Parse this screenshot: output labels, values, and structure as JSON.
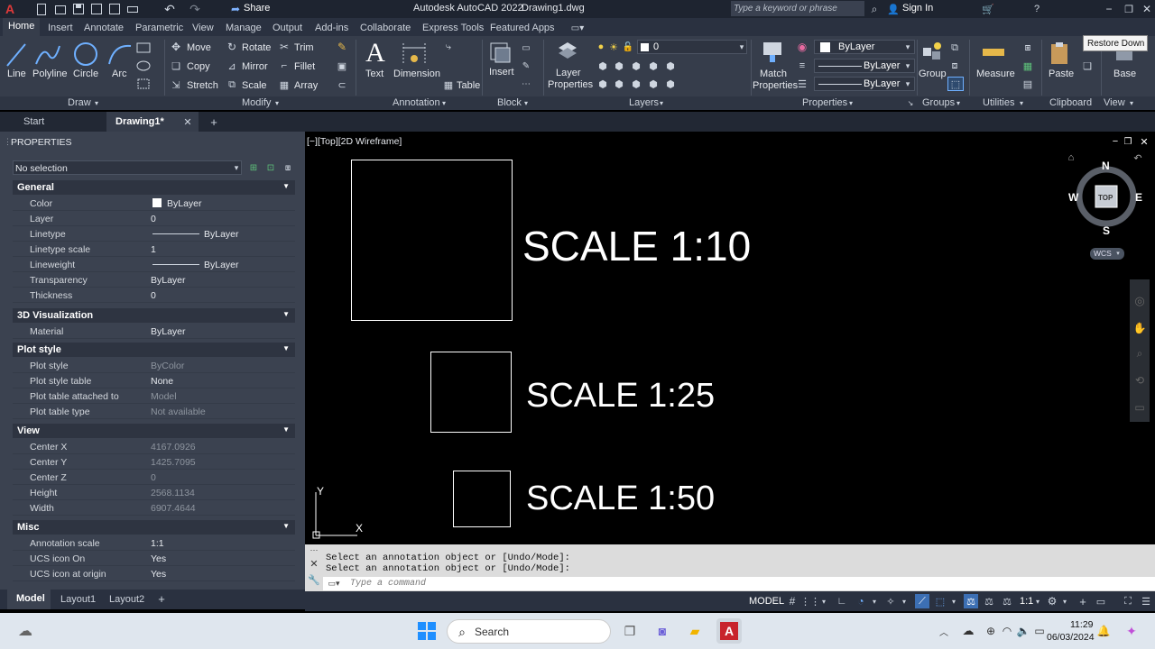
{
  "titlebar": {
    "share": "Share",
    "app_title": "Autodesk AutoCAD 2022",
    "file_name": "Drawing1.dwg",
    "search_placeholder": "Type a keyword or phrase",
    "sign_in": "Sign In"
  },
  "ribbon_tabs": [
    "Home",
    "Insert",
    "Annotate",
    "Parametric",
    "View",
    "Manage",
    "Output",
    "Add-ins",
    "Collaborate",
    "Express Tools",
    "Featured Apps"
  ],
  "draw": {
    "line": "Line",
    "polyline": "Polyline",
    "circle": "Circle",
    "arc": "Arc",
    "group": "Draw"
  },
  "modify": {
    "move": "Move",
    "rotate": "Rotate",
    "trim": "Trim",
    "copy": "Copy",
    "mirror": "Mirror",
    "fillet": "Fillet",
    "stretch": "Stretch",
    "scale": "Scale",
    "array": "Array",
    "group": "Modify"
  },
  "annotation": {
    "text": "Text",
    "dimension": "Dimension",
    "table": "Table",
    "group": "Annotation"
  },
  "block": {
    "insert": "Insert",
    "group": "Block"
  },
  "layers": {
    "layer_properties_1": "Layer",
    "layer_properties_2": "Properties",
    "current_layer": "0",
    "group": "Layers"
  },
  "properties": {
    "match_1": "Match",
    "match_2": "Properties",
    "color": "ByLayer",
    "linetype": "ByLayer",
    "lineweight": "ByLayer",
    "group": "Properties"
  },
  "groups": {
    "group_btn": "Group",
    "group": "Groups"
  },
  "utilities": {
    "measure": "Measure",
    "group": "Utilities"
  },
  "clipboard": {
    "paste": "Paste",
    "group": "Clipboard"
  },
  "view_panel": {
    "base": "Base",
    "group": "View"
  },
  "tooltip": "Restore Down",
  "doc_tabs": {
    "start": "Start",
    "drawing": "Drawing1*"
  },
  "props_panel": {
    "title": "PROPERTIES",
    "selection": "No selection",
    "sections": [
      {
        "name": "General",
        "rows": [
          {
            "k": "Color",
            "v": "ByLayer"
          },
          {
            "k": "Layer",
            "v": "0"
          },
          {
            "k": "Linetype",
            "v": "ByLayer"
          },
          {
            "k": "Linetype scale",
            "v": "1"
          },
          {
            "k": "Lineweight",
            "v": "ByLayer"
          },
          {
            "k": "Transparency",
            "v": "ByLayer"
          },
          {
            "k": "Thickness",
            "v": "0"
          }
        ]
      },
      {
        "name": "3D Visualization",
        "rows": [
          {
            "k": "Material",
            "v": "ByLayer"
          }
        ]
      },
      {
        "name": "Plot style",
        "rows": [
          {
            "k": "Plot style",
            "v": "ByColor"
          },
          {
            "k": "Plot style table",
            "v": "None"
          },
          {
            "k": "Plot table attached to",
            "v": "Model"
          },
          {
            "k": "Plot table type",
            "v": "Not available"
          }
        ]
      },
      {
        "name": "View",
        "rows": [
          {
            "k": "Center X",
            "v": "4167.0926"
          },
          {
            "k": "Center Y",
            "v": "1425.7095"
          },
          {
            "k": "Center Z",
            "v": "0"
          },
          {
            "k": "Height",
            "v": "2568.1134"
          },
          {
            "k": "Width",
            "v": "6907.4644"
          }
        ]
      },
      {
        "name": "Misc",
        "rows": [
          {
            "k": "Annotation scale",
            "v": "1:1"
          },
          {
            "k": "UCS icon On",
            "v": "Yes"
          },
          {
            "k": "UCS icon at origin",
            "v": "Yes"
          }
        ]
      }
    ]
  },
  "viewport": {
    "label": "[−][Top][2D Wireframe]",
    "scale1": "SCALE 1:10",
    "scale2": "SCALE 1:25",
    "scale3": "SCALE 1:50",
    "ucs_y": "Y",
    "ucs_x": "X"
  },
  "viewcube": {
    "n": "N",
    "s": "S",
    "e": "E",
    "w": "W",
    "top": "TOP",
    "wcs": "WCS"
  },
  "command": {
    "line1": "Select an annotation object or [Undo/Mode]:",
    "line2": "Select an annotation object or [Undo/Mode]:",
    "placeholder": "Type a command"
  },
  "layout_tabs": [
    "Model",
    "Layout1",
    "Layout2"
  ],
  "status": {
    "model": "MODEL",
    "scale": "1:1"
  },
  "taskbar": {
    "search": "Search",
    "time": "11:29",
    "date": "06/03/2024"
  }
}
